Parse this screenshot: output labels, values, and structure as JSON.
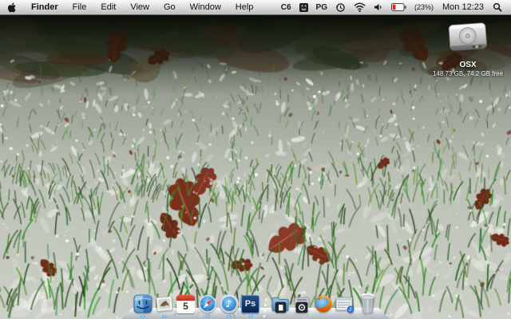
{
  "menu_bar": {
    "menus": [
      "Finder",
      "File",
      "Edit",
      "View",
      "Go",
      "Window",
      "Help"
    ],
    "status": {
      "left_text": "C6",
      "right_text": "PG",
      "battery_percent": "(23%)",
      "clock": "Mon 12:23"
    }
  },
  "desktop": {
    "volume": {
      "name": "OSX",
      "info": "148.73 GB, 74.2 GB free"
    }
  },
  "dock": {
    "ical_date": "5",
    "photoshop_label": "Ps",
    "itunes_glyph": "♪",
    "items": [
      {
        "name": "finder",
        "running": true
      },
      {
        "name": "mail",
        "running": true
      },
      {
        "name": "ical",
        "running": false
      },
      {
        "name": "safari",
        "running": true
      },
      {
        "name": "itunes",
        "running": true
      },
      {
        "name": "photoshop",
        "running": true
      },
      {
        "name": "separator",
        "running": false
      },
      {
        "name": "documents-stack",
        "running": false
      },
      {
        "name": "downloads-stack",
        "running": false
      },
      {
        "name": "firefox",
        "running": false
      },
      {
        "name": "minimized-window",
        "running": false
      },
      {
        "name": "trash-full",
        "running": false
      }
    ]
  },
  "icons": {
    "menu_right": [
      "input-menu-icon",
      "time-machine-icon",
      "wifi-icon",
      "volume-icon",
      "battery-icon",
      "spotlight-icon"
    ],
    "battery_state": "low"
  },
  "colors": {
    "indicator_blue": "#5aa7f0",
    "battery_low_red": "#cf2d24",
    "leaf_red": "#7d2f1d",
    "grass_green": "#3c7a28",
    "menubar_gray": "#d6d6d6"
  }
}
